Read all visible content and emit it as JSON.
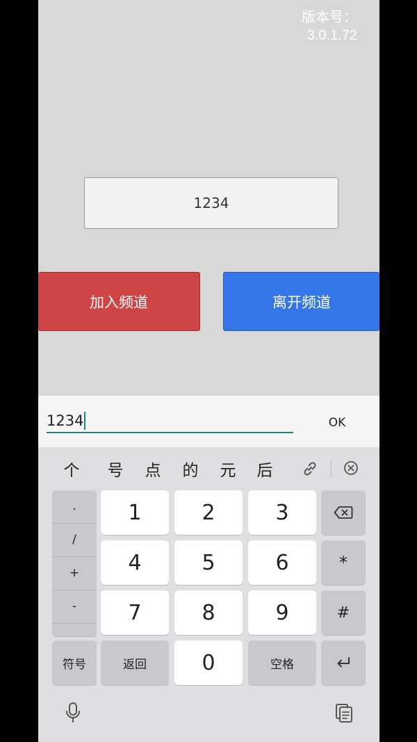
{
  "app": {
    "version_label": "版本号：",
    "version_value": "3.0.1.72",
    "channel_input_value": "1234",
    "join_button": "加入频道",
    "leave_button": "离开频道"
  },
  "ime": {
    "input_value": "1234",
    "ok_label": "OK"
  },
  "candidates": [
    "个",
    "号",
    "点",
    "的",
    "元",
    "后"
  ],
  "keyboard": {
    "symbols": [
      ".",
      "/",
      "+",
      "-"
    ],
    "digits": [
      "1",
      "2",
      "3",
      "4",
      "5",
      "6",
      "7",
      "8",
      "9",
      "0"
    ],
    "asterisk": "*",
    "hash": "#",
    "symbols_key": "符号",
    "back_key": "返回",
    "space_key": "空格"
  },
  "icons": {
    "backspace": "backspace-icon",
    "enter": "enter-icon",
    "mic": "mic-icon",
    "clipboard": "clipboard-icon",
    "link": "link-icon",
    "close": "close-candidates-icon"
  },
  "colors": {
    "join": "#cf4545",
    "leave": "#3576e8",
    "accent": "#16877a"
  }
}
